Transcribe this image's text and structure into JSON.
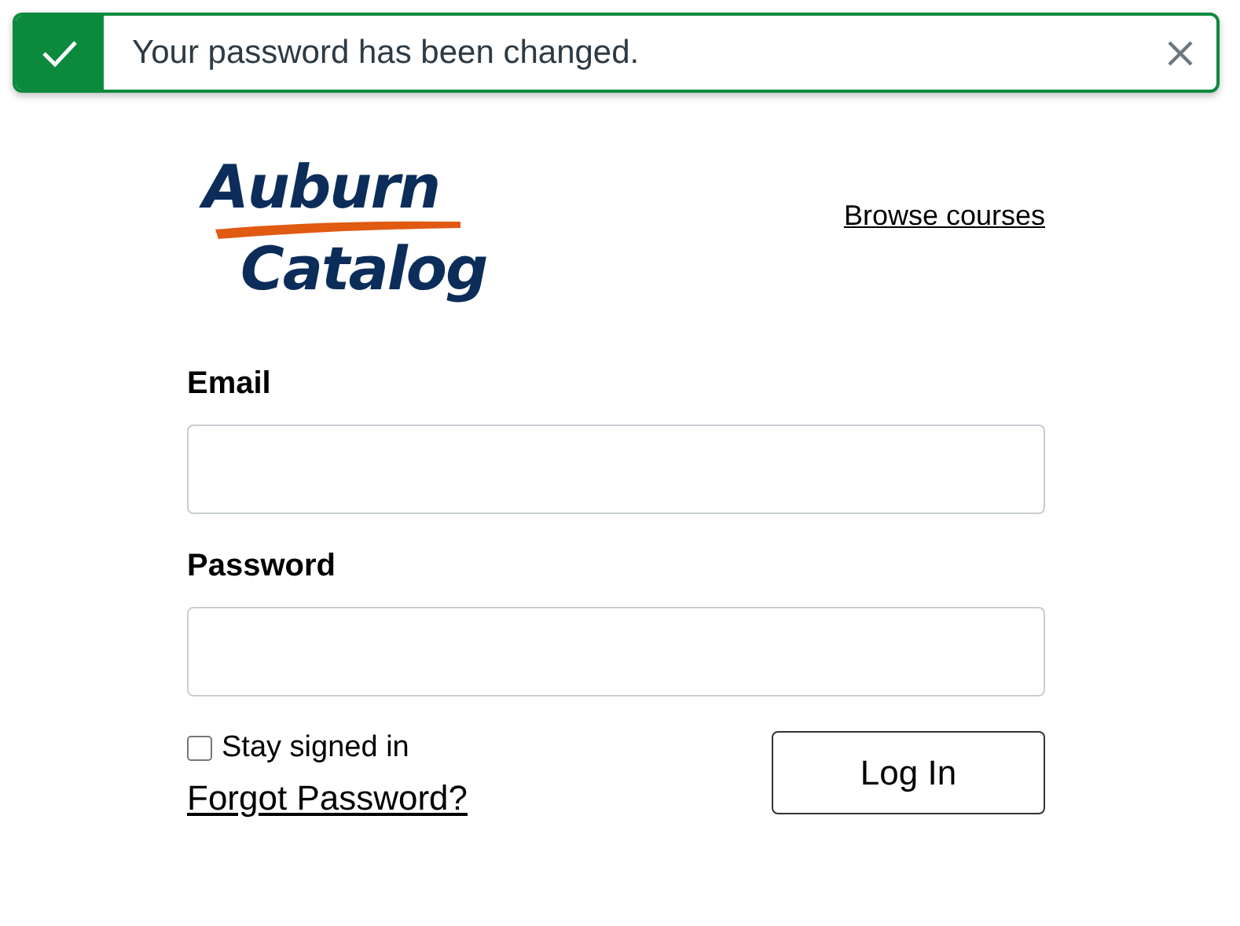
{
  "toast": {
    "message": "Your password has been changed."
  },
  "logo": {
    "line_1": "Auburn",
    "line_2": "Catalog"
  },
  "browse_link": "Browse courses",
  "fields": [
    {
      "label": "Email"
    },
    {
      "label": "Password"
    }
  ],
  "stay_signed_in": {
    "label": "Stay signed in",
    "checked": false
  },
  "forgot_link": "Forgot Password?",
  "login_button": "Log In"
}
